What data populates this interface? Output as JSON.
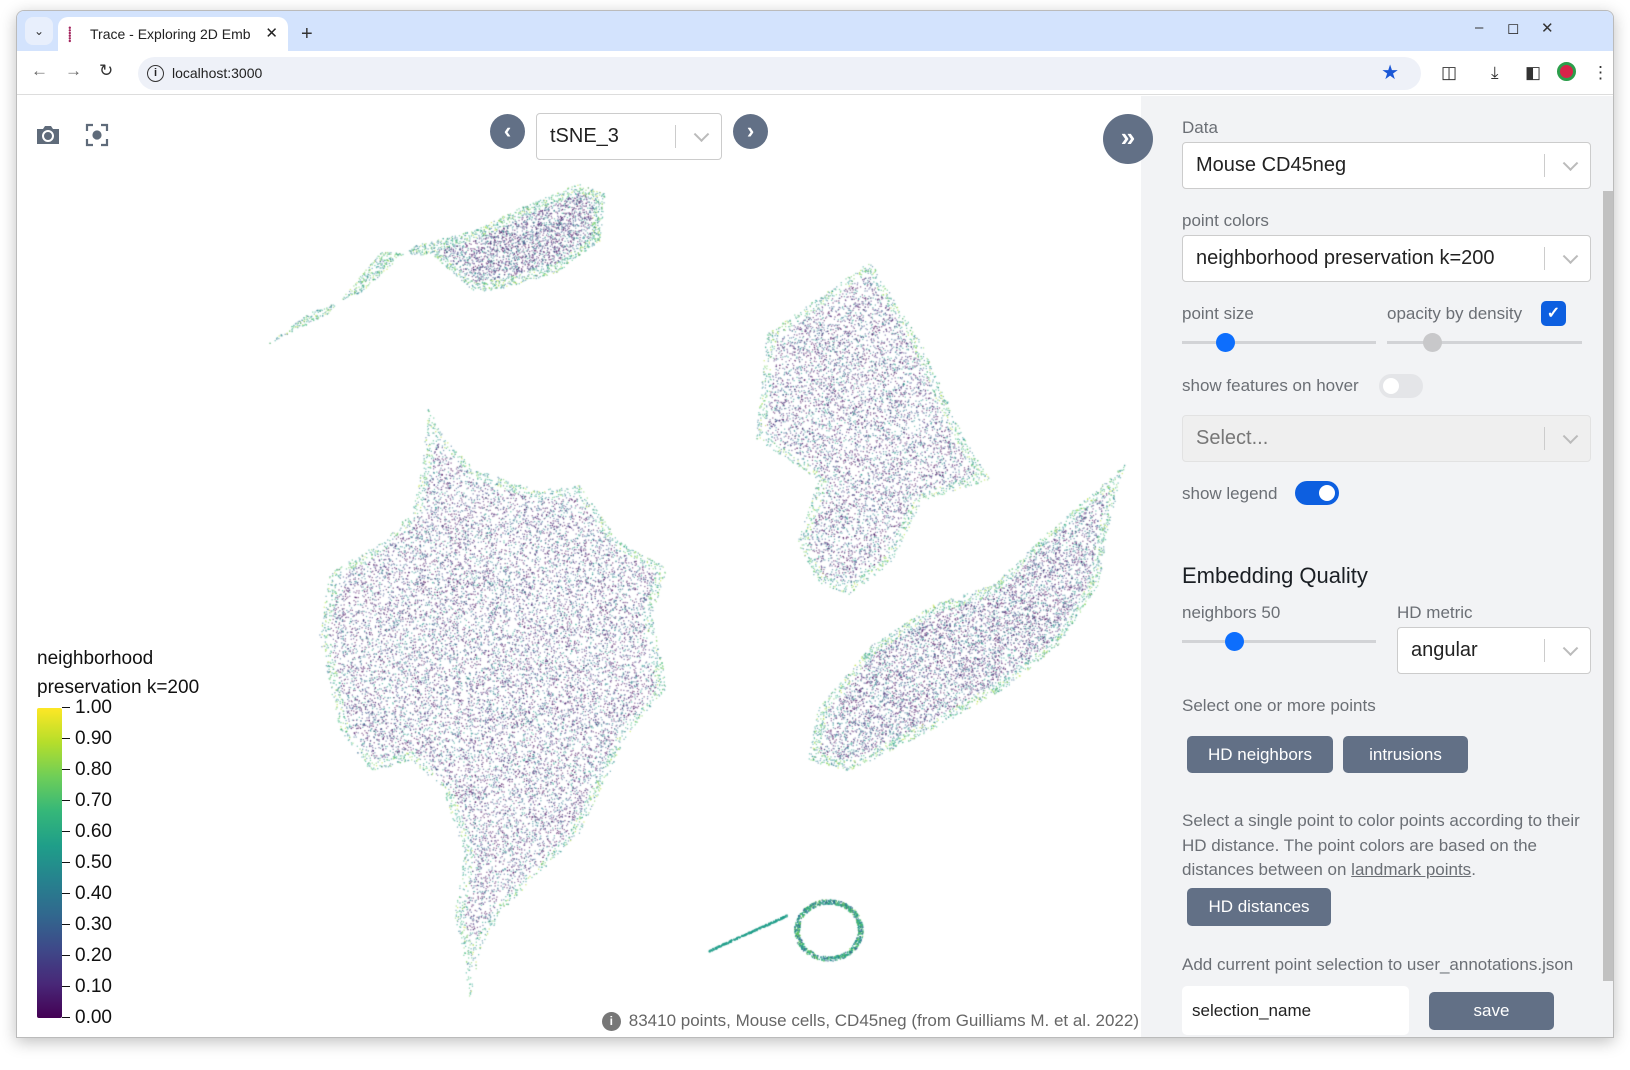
{
  "browser": {
    "tab_title": "Trace - Exploring 2D Emb",
    "url": "localhost:3000",
    "icons": [
      "tab-list-icon",
      "close-icon",
      "new-tab-icon",
      "back-icon",
      "forward-icon",
      "reload-icon",
      "site-info-icon",
      "bookmark-star-icon",
      "extensions-icon",
      "download-icon",
      "side-panel-icon",
      "profile-icon",
      "menu-icon",
      "minimize-icon",
      "maximize-icon",
      "window-close-icon"
    ]
  },
  "plot": {
    "embedding": "tSNE_3",
    "legend": {
      "title_line1": "neighborhood",
      "title_line2": "preservation k=200",
      "ticks": [
        "1.00",
        "0.90",
        "0.80",
        "0.70",
        "0.60",
        "0.50",
        "0.40",
        "0.30",
        "0.20",
        "0.10",
        "0.00"
      ],
      "colormap": "viridis"
    },
    "footer": "83410 points, Mouse cells, CD45neg (from Guilliams M. et al. 2022)"
  },
  "sidebar": {
    "data_label": "Data",
    "data_value": "Mouse CD45neg",
    "point_colors_label": "point colors",
    "point_colors_value": "neighborhood preservation k=200",
    "point_size_label": "point size",
    "point_size_fraction": 0.22,
    "opacity_label": "opacity by density",
    "opacity_checked": true,
    "opacity_fraction": 0.23,
    "show_features_label": "show features on hover",
    "show_features_on": false,
    "feature_placeholder": "Select...",
    "show_legend_label": "show legend",
    "show_legend_on": true,
    "quality_title": "Embedding Quality",
    "neighbors_label": "neighbors 50",
    "neighbors_fraction": 0.27,
    "hd_metric_label": "HD metric",
    "hd_metric_value": "angular",
    "select_points_label": "Select one or more points",
    "hd_neighbors_btn": "HD neighbors",
    "intrusions_btn": "intrusions",
    "para_text": "Select a single point to color points according to their HD distance. The point colors are based on the distances between on ",
    "para_link": "landmark points",
    "para_end": ".",
    "hd_distances_btn": "HD distances",
    "add_selection_label": "Add current point selection to user_annotations.json",
    "selection_input_value": "selection_name",
    "save_btn": "save"
  }
}
